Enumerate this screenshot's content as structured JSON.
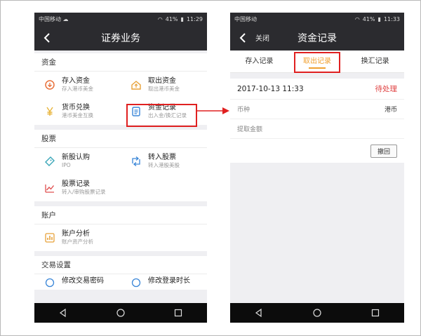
{
  "left_screen": {
    "status": {
      "carrier": "中国移动 ☁",
      "battery": "41%",
      "time": "11:29"
    },
    "title": "证券业务",
    "sections": [
      {
        "heading": "资金",
        "items": [
          {
            "name": "存入资金",
            "desc": "存入港币美金",
            "icon": "deposit-icon"
          },
          {
            "name": "取出资金",
            "desc": "取出港币美金",
            "icon": "withdraw-icon"
          },
          {
            "name": "货币兑换",
            "desc": "港币美金互换",
            "icon": "yen-icon"
          },
          {
            "name": "资金记录",
            "desc": "出入金/换汇记录",
            "icon": "records-icon"
          }
        ]
      },
      {
        "heading": "股票",
        "items": [
          {
            "name": "新股认购",
            "desc": "IPO",
            "icon": "ticket-icon"
          },
          {
            "name": "转入股票",
            "desc": "转入港股美股",
            "icon": "transfer-icon"
          },
          {
            "name": "股票记录",
            "desc": "转入/审购股票记录",
            "icon": "stock-chart-icon"
          }
        ]
      },
      {
        "heading": "账户",
        "items": [
          {
            "name": "账户分析",
            "desc": "账户资产分析",
            "icon": "analysis-icon"
          }
        ]
      },
      {
        "heading": "交易设置",
        "items": [
          {
            "name": "修改交易密码",
            "desc": "",
            "icon": "password-icon"
          },
          {
            "name": "修改登录时长",
            "desc": "",
            "icon": "timer-icon"
          }
        ]
      }
    ]
  },
  "right_screen": {
    "status": {
      "carrier": "中国移动",
      "battery": "41%",
      "time": "11:33"
    },
    "close_label": "关闭",
    "title": "资金记录",
    "tabs": [
      "存入记录",
      "取出记录",
      "换汇记录"
    ],
    "active_tab": 1,
    "record": {
      "datetime": "2017-10-13 11:33",
      "status": "待处理",
      "currency_label": "币种",
      "currency_value": "港币",
      "amount_label": "提取金额",
      "withdraw_button": "撤回"
    }
  },
  "colors": {
    "highlight": "#e02020",
    "accent": "#f0a030",
    "pending": "#e04545",
    "titlebar": "#2b2b2f"
  }
}
